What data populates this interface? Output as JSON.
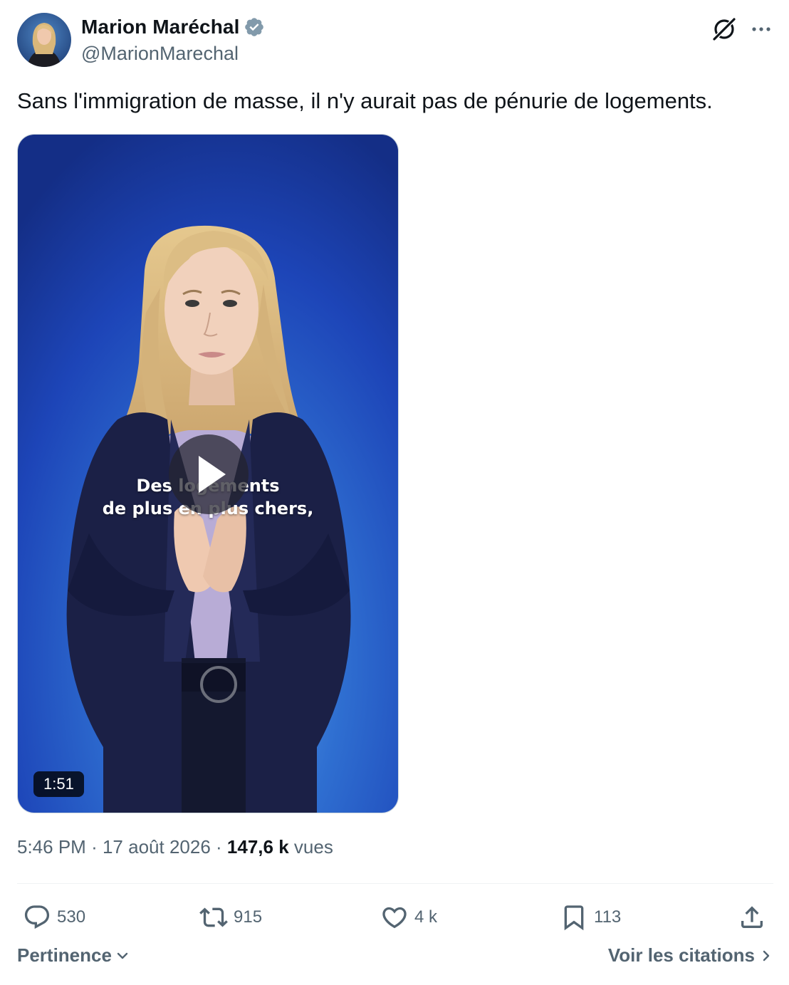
{
  "author": {
    "display_name": "Marion Maréchal",
    "handle": "@MarionMarechal",
    "verified_color": "#829aab"
  },
  "header_icons": [
    "grok-icon",
    "more-icon"
  ],
  "tweet": {
    "text": "Sans l'immigration de masse, il n'y aurait pas de pénurie de logements."
  },
  "video": {
    "caption_line_1": "Des logements",
    "caption_line_2": "de plus en plus chers,",
    "duration": "1:51",
    "background_color": "#1d45b8"
  },
  "meta": {
    "time": "5:46 PM",
    "separator": "·",
    "date": "17 août 2026",
    "views_count": "147,6 k",
    "views_label": "vues"
  },
  "actions": {
    "replies": "530",
    "reposts": "915",
    "likes": "4 k",
    "bookmarks": "113"
  },
  "footer": {
    "sort_label": "Pertinence",
    "quotes_label": "Voir les citations"
  },
  "colors": {
    "text_primary": "#0f1419",
    "text_secondary": "#536471",
    "divider": "#eff3f4"
  }
}
